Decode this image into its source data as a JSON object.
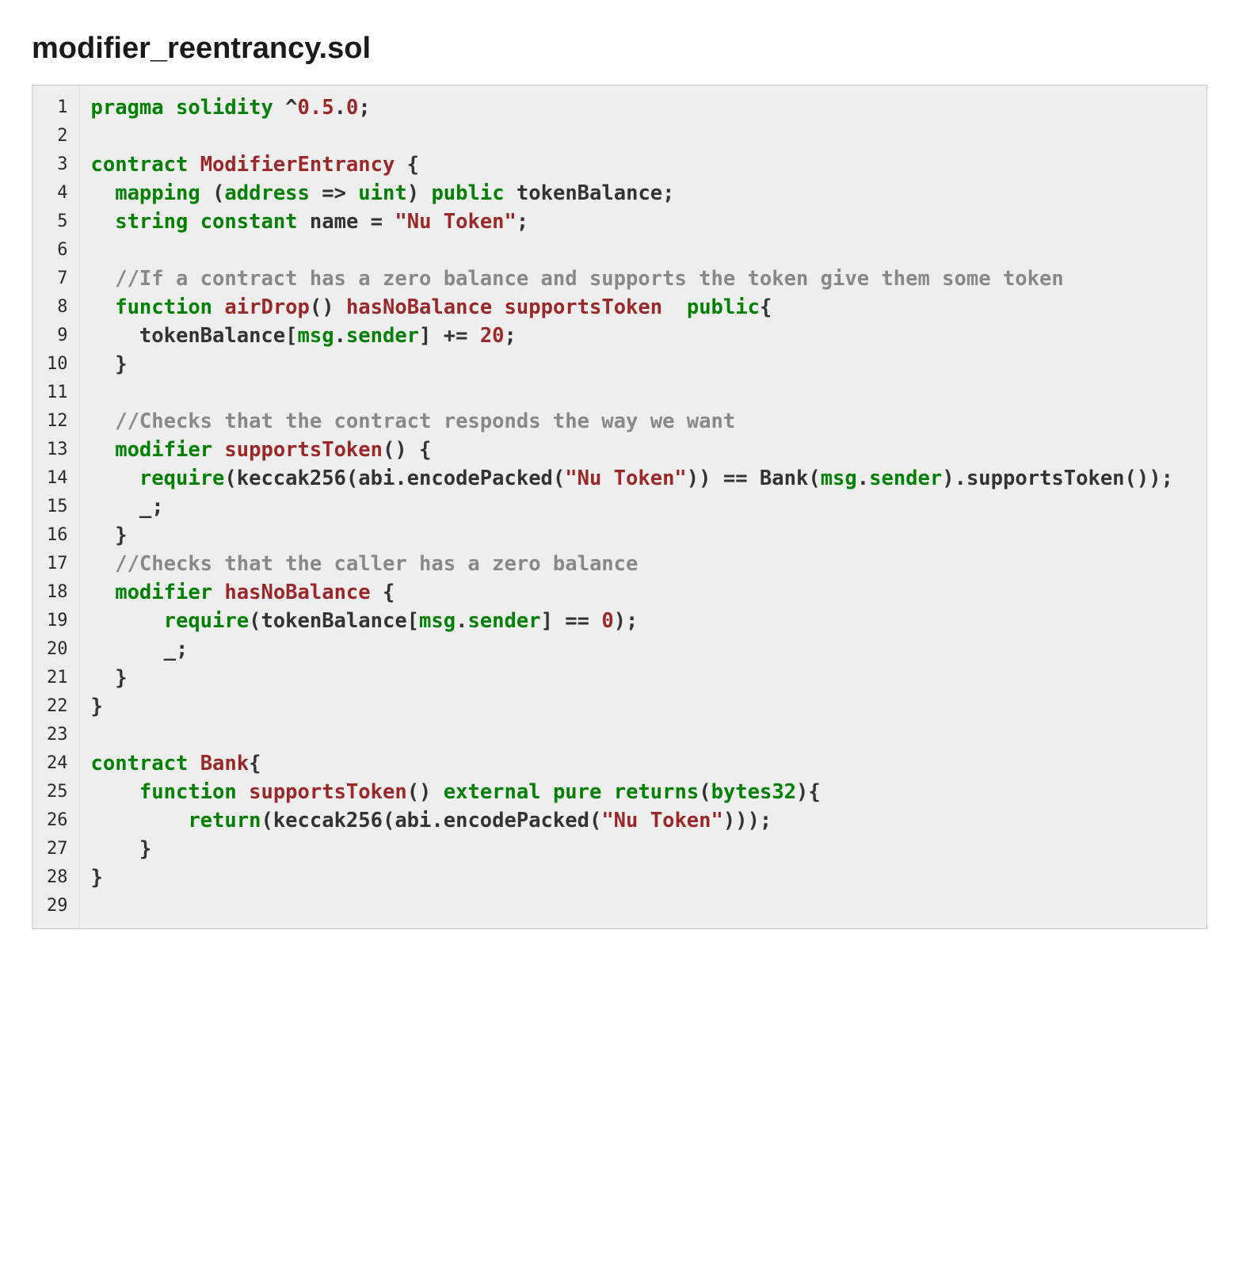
{
  "title": "modifier_reentrancy.sol",
  "lines": [
    {
      "n": 1,
      "tokens": [
        [
          "kw",
          "pragma"
        ],
        [
          "pl",
          " "
        ],
        [
          "kw",
          "solidity"
        ],
        [
          "pl",
          " ^"
        ],
        [
          "num",
          "0.5"
        ],
        [
          "pl",
          "."
        ],
        [
          "num",
          "0"
        ],
        [
          "pl",
          ";"
        ]
      ]
    },
    {
      "n": 2,
      "tokens": [
        [
          "pl",
          ""
        ]
      ]
    },
    {
      "n": 3,
      "tokens": [
        [
          "kw",
          "contract"
        ],
        [
          "pl",
          " "
        ],
        [
          "ty",
          "ModifierEntrancy"
        ],
        [
          "pl",
          " {"
        ]
      ]
    },
    {
      "n": 4,
      "tokens": [
        [
          "pl",
          "  "
        ],
        [
          "kw",
          "mapping"
        ],
        [
          "pl",
          " ("
        ],
        [
          "kw",
          "address"
        ],
        [
          "pl",
          " => "
        ],
        [
          "kw",
          "uint"
        ],
        [
          "pl",
          ") "
        ],
        [
          "kw",
          "public"
        ],
        [
          "pl",
          " tokenBalance;"
        ]
      ]
    },
    {
      "n": 5,
      "tokens": [
        [
          "pl",
          "  "
        ],
        [
          "kw",
          "string"
        ],
        [
          "pl",
          " "
        ],
        [
          "kw",
          "constant"
        ],
        [
          "pl",
          " name = "
        ],
        [
          "str",
          "\"Nu Token\""
        ],
        [
          "pl",
          ";"
        ]
      ]
    },
    {
      "n": 6,
      "tokens": [
        [
          "pl",
          ""
        ]
      ]
    },
    {
      "n": 7,
      "tokens": [
        [
          "pl",
          "  "
        ],
        [
          "cm",
          "//If a contract has a zero balance and supports the token give them some token"
        ]
      ]
    },
    {
      "n": 8,
      "tokens": [
        [
          "pl",
          "  "
        ],
        [
          "kw",
          "function"
        ],
        [
          "pl",
          " "
        ],
        [
          "fn",
          "airDrop"
        ],
        [
          "pl",
          "() "
        ],
        [
          "fn",
          "hasNoBalance"
        ],
        [
          "pl",
          " "
        ],
        [
          "fn",
          "supportsToken"
        ],
        [
          "pl",
          "  "
        ],
        [
          "kw",
          "public"
        ],
        [
          "pl",
          "{"
        ]
      ]
    },
    {
      "n": 9,
      "tokens": [
        [
          "pl",
          "    tokenBalance["
        ],
        [
          "kw",
          "msg"
        ],
        [
          "pl",
          "."
        ],
        [
          "kw",
          "sender"
        ],
        [
          "pl",
          "] += "
        ],
        [
          "num",
          "20"
        ],
        [
          "pl",
          ";"
        ]
      ]
    },
    {
      "n": 10,
      "tokens": [
        [
          "pl",
          "  }"
        ]
      ]
    },
    {
      "n": 11,
      "tokens": [
        [
          "pl",
          ""
        ]
      ]
    },
    {
      "n": 12,
      "tokens": [
        [
          "pl",
          "  "
        ],
        [
          "cm",
          "//Checks that the contract responds the way we want"
        ]
      ]
    },
    {
      "n": 13,
      "tokens": [
        [
          "pl",
          "  "
        ],
        [
          "kw",
          "modifier"
        ],
        [
          "pl",
          " "
        ],
        [
          "fn",
          "supportsToken"
        ],
        [
          "pl",
          "() {"
        ]
      ]
    },
    {
      "n": 14,
      "tokens": [
        [
          "pl",
          "    "
        ],
        [
          "kw",
          "require"
        ],
        [
          "pl",
          "(keccak256(abi.encodePacked("
        ],
        [
          "str",
          "\"Nu Token\""
        ],
        [
          "pl",
          ")) == Bank("
        ],
        [
          "kw",
          "msg"
        ],
        [
          "pl",
          "."
        ],
        [
          "kw",
          "sender"
        ],
        [
          "pl",
          ").supportsToken());"
        ]
      ]
    },
    {
      "n": 15,
      "tokens": [
        [
          "pl",
          "    _;"
        ]
      ]
    },
    {
      "n": 16,
      "tokens": [
        [
          "pl",
          "  }"
        ]
      ]
    },
    {
      "n": 17,
      "tokens": [
        [
          "pl",
          "  "
        ],
        [
          "cm",
          "//Checks that the caller has a zero balance"
        ]
      ]
    },
    {
      "n": 18,
      "tokens": [
        [
          "pl",
          "  "
        ],
        [
          "kw",
          "modifier"
        ],
        [
          "pl",
          " "
        ],
        [
          "fn",
          "hasNoBalance"
        ],
        [
          "pl",
          " {"
        ]
      ]
    },
    {
      "n": 19,
      "tokens": [
        [
          "pl",
          "      "
        ],
        [
          "kw",
          "require"
        ],
        [
          "pl",
          "(tokenBalance["
        ],
        [
          "kw",
          "msg"
        ],
        [
          "pl",
          "."
        ],
        [
          "kw",
          "sender"
        ],
        [
          "pl",
          "] == "
        ],
        [
          "num",
          "0"
        ],
        [
          "pl",
          ");"
        ]
      ]
    },
    {
      "n": 20,
      "tokens": [
        [
          "pl",
          "      _;"
        ]
      ]
    },
    {
      "n": 21,
      "tokens": [
        [
          "pl",
          "  }"
        ]
      ]
    },
    {
      "n": 22,
      "tokens": [
        [
          "pl",
          "}"
        ]
      ]
    },
    {
      "n": 23,
      "tokens": [
        [
          "pl",
          ""
        ]
      ]
    },
    {
      "n": 24,
      "tokens": [
        [
          "kw",
          "contract"
        ],
        [
          "pl",
          " "
        ],
        [
          "ty",
          "Bank"
        ],
        [
          "pl",
          "{"
        ]
      ]
    },
    {
      "n": 25,
      "tokens": [
        [
          "pl",
          "    "
        ],
        [
          "kw",
          "function"
        ],
        [
          "pl",
          " "
        ],
        [
          "fn",
          "supportsToken"
        ],
        [
          "pl",
          "() "
        ],
        [
          "kw",
          "external"
        ],
        [
          "pl",
          " "
        ],
        [
          "kw",
          "pure"
        ],
        [
          "pl",
          " "
        ],
        [
          "kw",
          "returns"
        ],
        [
          "pl",
          "("
        ],
        [
          "kw",
          "bytes32"
        ],
        [
          "pl",
          "){"
        ]
      ]
    },
    {
      "n": 26,
      "tokens": [
        [
          "pl",
          "        "
        ],
        [
          "kw",
          "return"
        ],
        [
          "pl",
          "(keccak256(abi.encodePacked("
        ],
        [
          "str",
          "\"Nu Token\""
        ],
        [
          "pl",
          ")));"
        ]
      ]
    },
    {
      "n": 27,
      "tokens": [
        [
          "pl",
          "    }"
        ]
      ]
    },
    {
      "n": 28,
      "tokens": [
        [
          "pl",
          "}"
        ]
      ]
    },
    {
      "n": 29,
      "tokens": [
        [
          "pl",
          ""
        ]
      ]
    }
  ]
}
